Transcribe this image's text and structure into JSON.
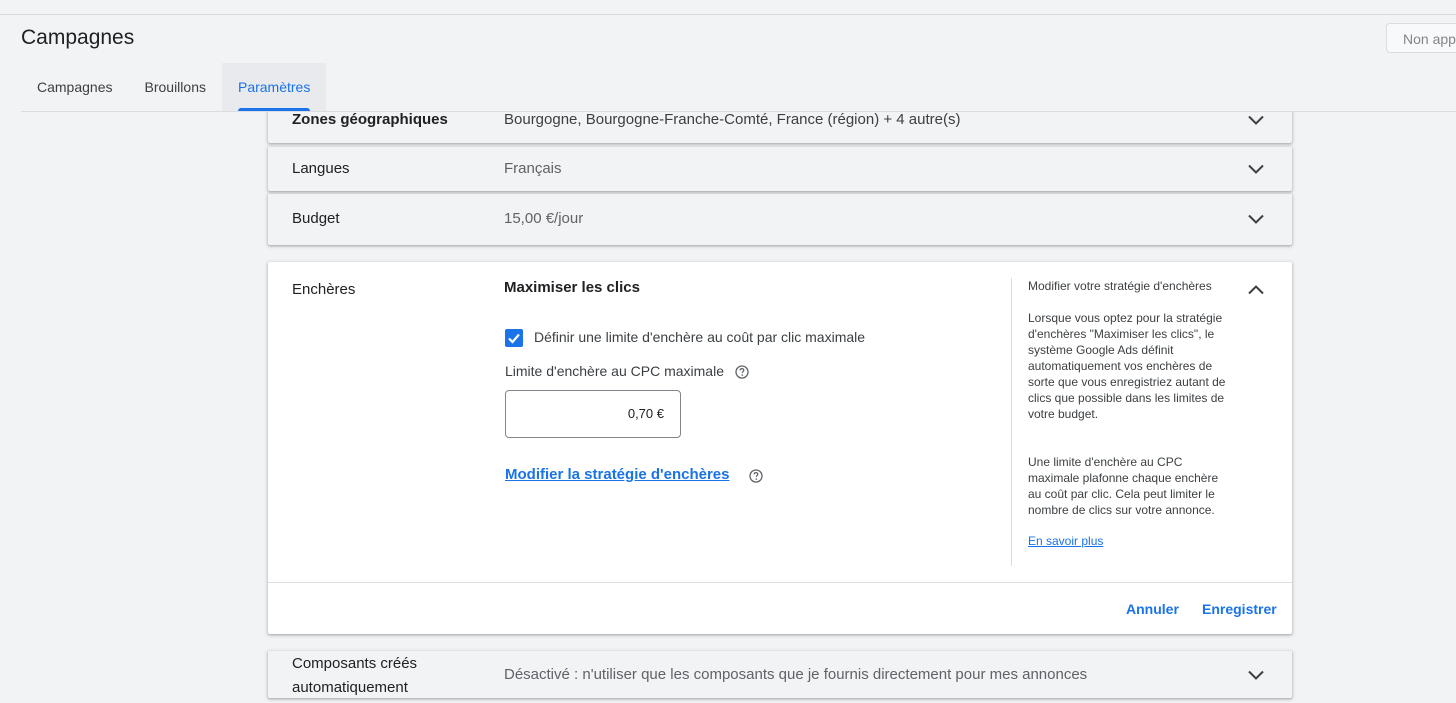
{
  "header": {
    "title": "Campagnes",
    "status": "Non approuvé"
  },
  "tabs": [
    {
      "label": "Campagnes"
    },
    {
      "label": "Brouillons"
    },
    {
      "label": "Paramètres"
    }
  ],
  "settings": {
    "locations": {
      "label": "Zones géographiques",
      "value": "Bourgogne, Bourgogne-Franche-Comté, France (région) + 4 autre(s)"
    },
    "languages": {
      "label": "Langues",
      "value": "Français"
    },
    "budget": {
      "label": "Budget",
      "value": "15,00 €/jour"
    },
    "bidding": {
      "label": "Enchères",
      "strategy": "Maximiser les clics",
      "checkbox_label": "Définir une limite d'enchère au coût par clic maximale",
      "checkbox_checked": true,
      "cpc_label": "Limite d'enchère au CPC maximale",
      "cpc_value": "0,70 €",
      "change_strategy_link": "Modifier la stratégie d'enchères",
      "help_title": "Modifier votre stratégie d'enchères",
      "help_paragraph_1": "Lorsque vous optez pour la stratégie d'enchères \"Maximiser les clics\", le système Google Ads définit automatiquement vos enchères de sorte que vous enregistriez autant de clics que possible dans les limites de votre budget.",
      "help_paragraph_2": "Une limite d'enchère au CPC maximale plafonne chaque enchère au coût par clic. Cela peut limiter le nombre de clics sur votre annonce.",
      "learn_more": "En savoir plus",
      "cancel_label": "Annuler",
      "save_label": "Enregistrer"
    },
    "auto_assets": {
      "label": "Composants créés automatiquement",
      "value": "Désactivé : n'utiliser que les composants que je fournis directement pour mes annonces"
    }
  },
  "colors": {
    "accent": "#1a73e8",
    "background": "#f1f3f4",
    "card": "#ffffff"
  }
}
